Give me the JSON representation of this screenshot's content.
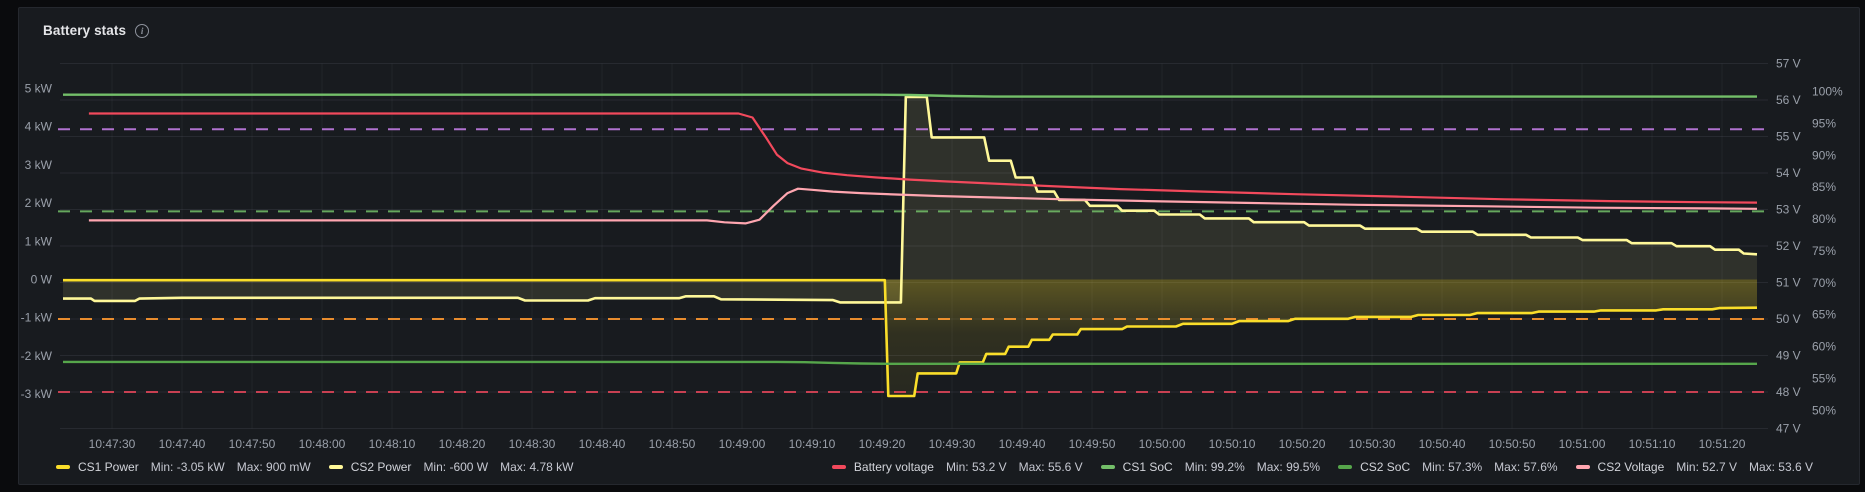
{
  "panel": {
    "title": "Battery stats",
    "info_icon": "i"
  },
  "chart_data": {
    "type": "line",
    "title": "Battery stats",
    "grid": true,
    "x_axis": {
      "t_min": -7.43,
      "t_max": 236.14,
      "tick_interval_s": 10,
      "tick_seconds": [
        0,
        10,
        20,
        30,
        40,
        50,
        60,
        70,
        80,
        90,
        100,
        110,
        120,
        130,
        140,
        150,
        160,
        170,
        180,
        190,
        200,
        210,
        220,
        230
      ],
      "tick_labels": [
        "10:47:30",
        "10:47:40",
        "10:47:50",
        "10:48:00",
        "10:48:10",
        "10:48:20",
        "10:48:30",
        "10:48:40",
        "10:48:50",
        "10:49:00",
        "10:49:10",
        "10:49:20",
        "10:49:30",
        "10:49:40",
        "10:49:50",
        "10:50:00",
        "10:50:10",
        "10:50:20",
        "10:50:30",
        "10:50:40",
        "10:50:50",
        "10:51:00",
        "10:51:10",
        "10:51:20"
      ]
    },
    "y_axes": {
      "kw": {
        "side": "left",
        "min": -3.902,
        "max": 5.655,
        "tick_values": [
          5,
          4,
          3,
          2,
          1,
          0,
          -1,
          -2,
          -3
        ],
        "tick_labels": [
          "5 kW",
          "4 kW",
          "3 kW",
          "2 kW",
          "1 kW",
          "0 W",
          "-1 kW",
          "-2 kW",
          "-3 kW"
        ]
      },
      "v": {
        "side": "right",
        "min": 47,
        "max": 57,
        "tick_values": [
          57,
          56,
          55,
          54,
          53,
          52,
          51,
          50,
          49,
          48,
          47
        ],
        "tick_labels": [
          "57 V",
          "56 V",
          "55 V",
          "54 V",
          "53 V",
          "52 V",
          "51 V",
          "50 V",
          "49 V",
          "48 V",
          "47 V"
        ]
      },
      "pct": {
        "side": "right2",
        "min": 47.16,
        "max": 104.39,
        "tick_values": [
          100,
          95,
          90,
          85,
          80,
          75,
          70,
          65,
          60,
          55,
          50
        ],
        "tick_labels": [
          "100%",
          "95%",
          "90%",
          "85%",
          "80%",
          "75%",
          "70%",
          "65%",
          "60%",
          "55%",
          "50%"
        ]
      }
    },
    "thresholds": [
      {
        "axis": "v",
        "value": 55.2,
        "color": "#b877d9",
        "opacity": 0.95
      },
      {
        "axis": "v",
        "value": 52.95,
        "color": "#73bf69",
        "opacity": 0.85
      },
      {
        "axis": "v",
        "value": 50.0,
        "color": "#ff9830",
        "opacity": 0.9
      },
      {
        "axis": "v",
        "value": 48.0,
        "color": "#f2495c",
        "opacity": 0.8
      }
    ],
    "series": [
      {
        "name": "CS2 Power",
        "axis": "kw",
        "color": "#fff899",
        "width": 2.6,
        "fill": "flat",
        "points": [
          [
            -7,
            -0.5
          ],
          [
            -3,
            -0.5
          ],
          [
            -2.5,
            -0.56
          ],
          [
            3.3,
            -0.56
          ],
          [
            3.9,
            -0.5
          ],
          [
            10,
            -0.48
          ],
          [
            58,
            -0.48
          ],
          [
            59,
            -0.55
          ],
          [
            68,
            -0.55
          ],
          [
            69,
            -0.49
          ],
          [
            81,
            -0.49
          ],
          [
            82,
            -0.44
          ],
          [
            86,
            -0.44
          ],
          [
            87,
            -0.52
          ],
          [
            103,
            -0.54
          ],
          [
            104,
            -0.6
          ],
          [
            112.7,
            -0.6
          ],
          [
            113.4,
            4.78
          ],
          [
            116.4,
            4.78
          ],
          [
            117.1,
            3.72
          ],
          [
            124.6,
            3.72
          ],
          [
            125.3,
            3.11
          ],
          [
            128.4,
            3.11
          ],
          [
            129.1,
            2.67
          ],
          [
            131.5,
            2.67
          ],
          [
            132.2,
            2.3
          ],
          [
            134.6,
            2.3
          ],
          [
            135.3,
            2.08
          ],
          [
            139,
            2.08
          ],
          [
            139.7,
            1.93
          ],
          [
            143.6,
            1.93
          ],
          [
            144.3,
            1.8
          ],
          [
            148.9,
            1.8
          ],
          [
            149.6,
            1.7
          ],
          [
            155.4,
            1.7
          ],
          [
            156.1,
            1.6
          ],
          [
            162.4,
            1.6
          ],
          [
            163.1,
            1.5
          ],
          [
            170.3,
            1.5
          ],
          [
            171,
            1.41
          ],
          [
            178.3,
            1.41
          ],
          [
            179,
            1.33
          ],
          [
            186.4,
            1.33
          ],
          [
            187.1,
            1.25
          ],
          [
            194.4,
            1.25
          ],
          [
            195.1,
            1.17
          ],
          [
            202,
            1.17
          ],
          [
            202.7,
            1.1
          ],
          [
            209.4,
            1.1
          ],
          [
            210.1,
            1.03
          ],
          [
            216.4,
            1.03
          ],
          [
            217.1,
            0.95
          ],
          [
            222.8,
            0.95
          ],
          [
            223.5,
            0.87
          ],
          [
            228.3,
            0.87
          ],
          [
            229,
            0.78
          ],
          [
            232.4,
            0.78
          ],
          [
            233.1,
            0.68
          ],
          [
            235,
            0.66
          ]
        ]
      },
      {
        "name": "CS1 Power",
        "axis": "kw",
        "color": "#fade2a",
        "width": 2.6,
        "fill": "gradient",
        "points": [
          [
            -7,
            -0.02
          ],
          [
            110.4,
            -0.02
          ],
          [
            110.9,
            -3.05
          ],
          [
            114.6,
            -3.05
          ],
          [
            115.1,
            -2.46
          ],
          [
            120.6,
            -2.46
          ],
          [
            121.1,
            -2.17
          ],
          [
            124.4,
            -2.17
          ],
          [
            124.9,
            -1.95
          ],
          [
            127.6,
            -1.95
          ],
          [
            128.1,
            -1.76
          ],
          [
            130.9,
            -1.76
          ],
          [
            131.4,
            -1.58
          ],
          [
            133.9,
            -1.58
          ],
          [
            134.4,
            -1.44
          ],
          [
            137.9,
            -1.44
          ],
          [
            138.4,
            -1.3
          ],
          [
            144.3,
            -1.3
          ],
          [
            145,
            -1.23
          ],
          [
            152,
            -1.23
          ],
          [
            153,
            -1.16
          ],
          [
            160,
            -1.16
          ],
          [
            161,
            -1.09
          ],
          [
            168,
            -1.09
          ],
          [
            169,
            -1.03
          ],
          [
            176.6,
            -1.03
          ],
          [
            177.6,
            -0.98
          ],
          [
            185.6,
            -0.98
          ],
          [
            186.6,
            -0.93
          ],
          [
            194,
            -0.93
          ],
          [
            195,
            -0.88
          ],
          [
            202.8,
            -0.88
          ],
          [
            203.8,
            -0.84
          ],
          [
            211.7,
            -0.84
          ],
          [
            212.7,
            -0.81
          ],
          [
            220.6,
            -0.81
          ],
          [
            221.6,
            -0.78
          ],
          [
            228.6,
            -0.78
          ],
          [
            229.6,
            -0.75
          ],
          [
            235,
            -0.74
          ]
        ]
      },
      {
        "name": "Battery voltage",
        "axis": "v",
        "color": "#f2495c",
        "width": 2.2,
        "fill": "none",
        "points": [
          [
            -3.3,
            55.63
          ],
          [
            89.5,
            55.63
          ],
          [
            91.5,
            55.52
          ],
          [
            93.5,
            54.95
          ],
          [
            95,
            54.5
          ],
          [
            96.5,
            54.27
          ],
          [
            98.5,
            54.12
          ],
          [
            101.5,
            54.01
          ],
          [
            105,
            53.94
          ],
          [
            109,
            53.88
          ],
          [
            114,
            53.82
          ],
          [
            119,
            53.77
          ],
          [
            126,
            53.71
          ],
          [
            134,
            53.64
          ],
          [
            144,
            53.56
          ],
          [
            156,
            53.49
          ],
          [
            169,
            53.42
          ],
          [
            184,
            53.35
          ],
          [
            199,
            53.28
          ],
          [
            214,
            53.23
          ],
          [
            227,
            53.2
          ],
          [
            235,
            53.19
          ]
        ]
      },
      {
        "name": "CS1 SoC",
        "axis": "pct",
        "color": "#73bf69",
        "width": 2.4,
        "fill": "none",
        "points": [
          [
            -7,
            99.5
          ],
          [
            109,
            99.5
          ],
          [
            114,
            99.45
          ],
          [
            120,
            99.3
          ],
          [
            126,
            99.2
          ],
          [
            235,
            99.2
          ]
        ]
      },
      {
        "name": "CS2 SoC",
        "axis": "pct",
        "color": "#56a64b",
        "width": 2.4,
        "fill": "none",
        "points": [
          [
            -7,
            57.6
          ],
          [
            95,
            57.6
          ],
          [
            99,
            57.55
          ],
          [
            103,
            57.45
          ],
          [
            107,
            57.35
          ],
          [
            111,
            57.3
          ],
          [
            235,
            57.3
          ]
        ]
      },
      {
        "name": "CS2 Voltage",
        "axis": "v",
        "color": "#ffa6b0",
        "width": 2.2,
        "fill": "none",
        "points": [
          [
            -3.3,
            52.7
          ],
          [
            85,
            52.7
          ],
          [
            87.5,
            52.65
          ],
          [
            90.5,
            52.62
          ],
          [
            92.5,
            52.72
          ],
          [
            94.5,
            53.1
          ],
          [
            96.5,
            53.45
          ],
          [
            98,
            53.57
          ],
          [
            100,
            53.54
          ],
          [
            103,
            53.49
          ],
          [
            107,
            53.45
          ],
          [
            112,
            53.41
          ],
          [
            118,
            53.37
          ],
          [
            126,
            53.33
          ],
          [
            136,
            53.28
          ],
          [
            148,
            53.23
          ],
          [
            162,
            53.18
          ],
          [
            178,
            53.13
          ],
          [
            195,
            53.09
          ],
          [
            212,
            53.05
          ],
          [
            228,
            53.03
          ],
          [
            235,
            53.02
          ]
        ]
      }
    ]
  },
  "legend": {
    "left": [
      {
        "name": "CS1 Power",
        "color": "#fade2a",
        "min": "Min: -3.05 kW",
        "max": "Max: 900 mW"
      },
      {
        "name": "CS2 Power",
        "color": "#fff899",
        "min": "Min: -600 W",
        "max": "Max: 4.78 kW"
      }
    ],
    "right": [
      {
        "name": "Battery voltage",
        "color": "#f2495c",
        "min": "Min: 53.2 V",
        "max": "Max: 55.6 V"
      },
      {
        "name": "CS1 SoC",
        "color": "#73bf69",
        "min": "Min: 99.2%",
        "max": "Max: 99.5%"
      },
      {
        "name": "CS2 SoC",
        "color": "#56a64b",
        "min": "Min: 57.3%",
        "max": "Max: 57.6%"
      },
      {
        "name": "CS2 Voltage",
        "color": "#ffa6b0",
        "min": "Min: 52.7 V",
        "max": "Max: 53.6 V"
      }
    ]
  }
}
